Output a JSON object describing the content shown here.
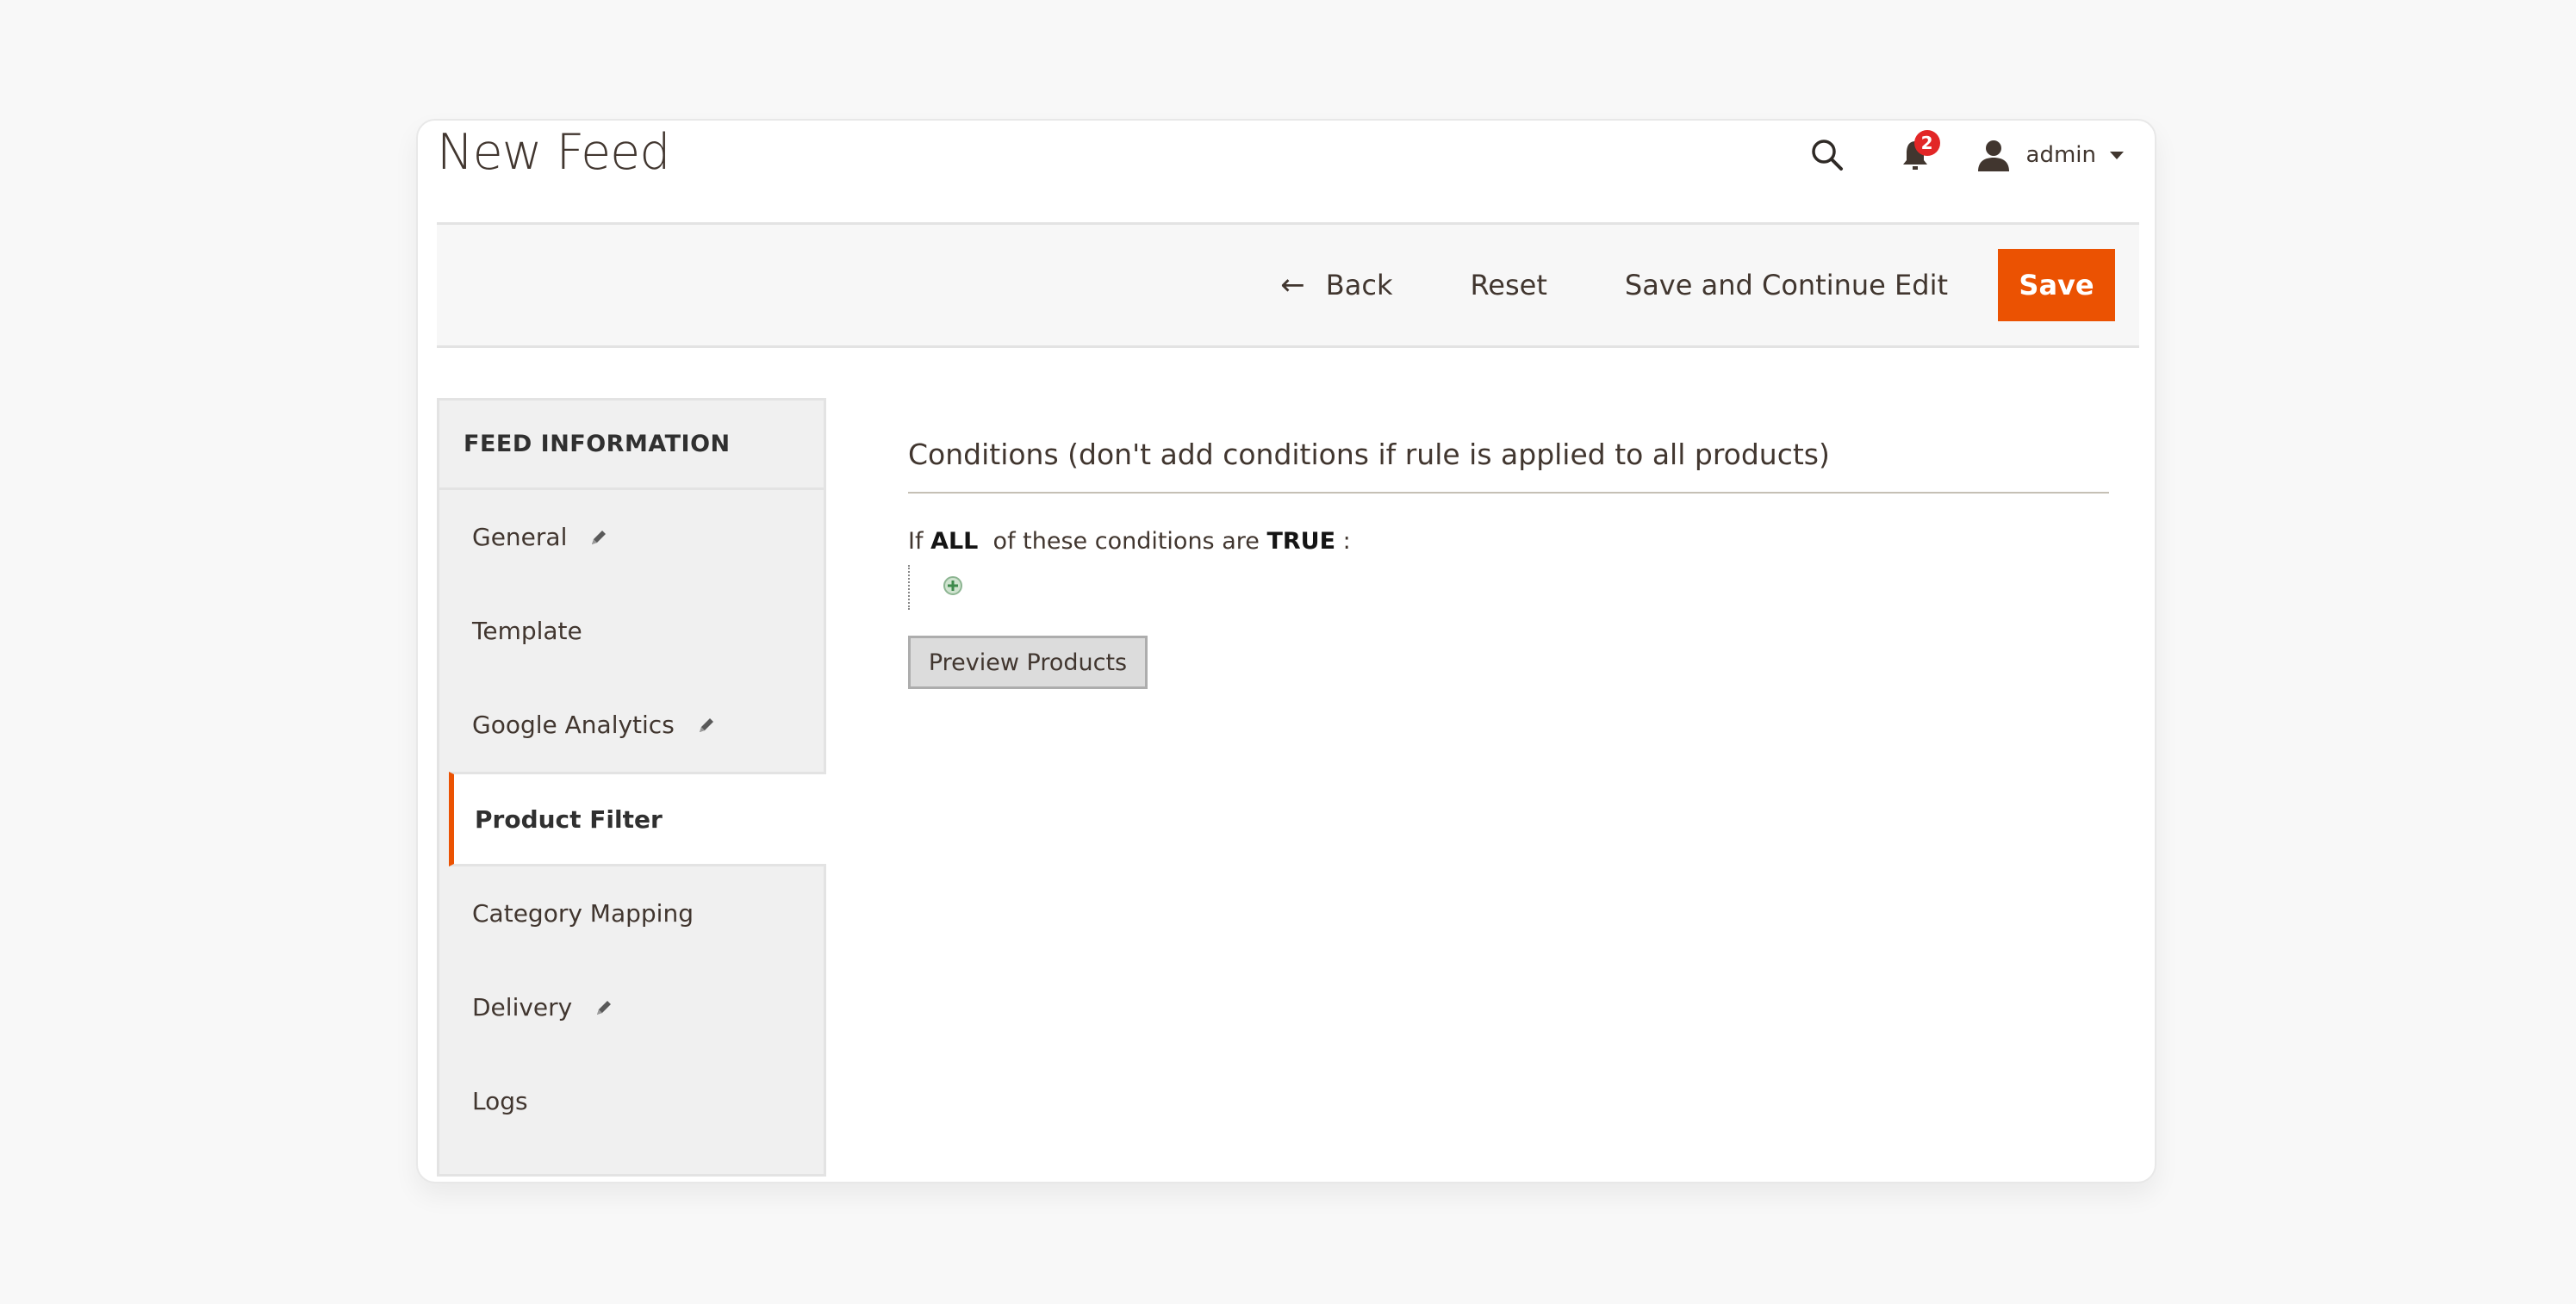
{
  "header": {
    "title": "New Feed",
    "notifications_count": "2",
    "user_name": "admin",
    "icons": {
      "search": "search-icon",
      "notifications": "bell-icon",
      "user": "user-icon",
      "dropdown": "caret-down-icon"
    }
  },
  "toolbar": {
    "back_label": "Back",
    "back_icon": "←",
    "reset_label": "Reset",
    "save_continue_label": "Save and Continue Edit",
    "save_label": "Save"
  },
  "sidebar": {
    "title": "FEED INFORMATION",
    "items": [
      {
        "label": "General",
        "edited": true
      },
      {
        "label": "Template",
        "edited": false
      },
      {
        "label": "Google Analytics",
        "edited": true
      },
      {
        "label": "Product Filter",
        "edited": false,
        "active": true
      },
      {
        "label": "Category Mapping",
        "edited": false
      },
      {
        "label": "Delivery",
        "edited": true
      },
      {
        "label": "Logs",
        "edited": false
      }
    ]
  },
  "main": {
    "section_title": "Conditions (don't add conditions if rule is applied to all products)",
    "condition": {
      "prefix": "If",
      "aggregator": "ALL",
      "middle": "of these conditions are",
      "value": "TRUE",
      "suffix": ":"
    },
    "preview_button_label": "Preview Products"
  },
  "colors": {
    "accent": "#eb5202",
    "badge": "#e22626",
    "text": "#41362f",
    "sidebar_bg": "#f0f0f0",
    "toolbar_bg": "#f7f7f7",
    "add_icon": "#3d8a4b"
  }
}
